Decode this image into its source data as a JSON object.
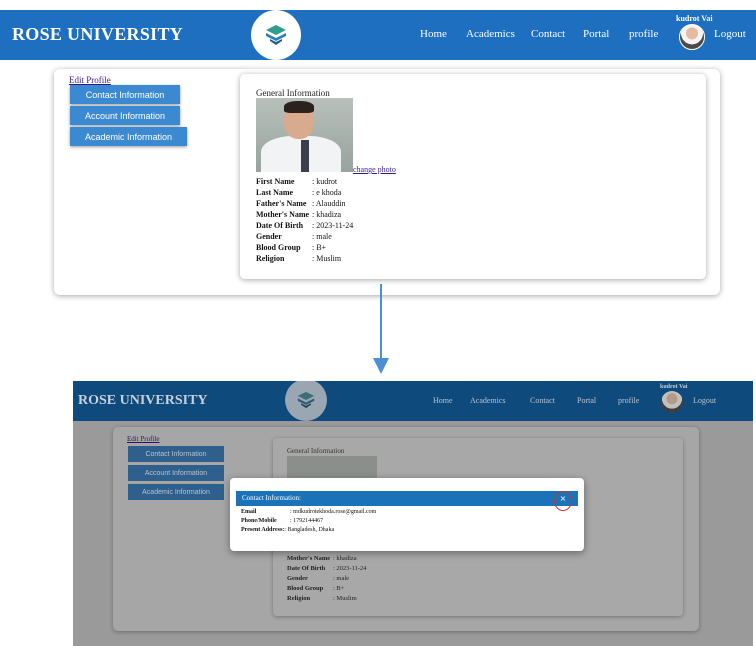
{
  "top_screen": {
    "nav": {
      "brand": "ROSE UNIVERSITY",
      "menu": [
        "Home",
        "Academics",
        "Contact",
        "Portal",
        "profile"
      ],
      "user_name": "kudrot Vai",
      "logout": "Logout",
      "bar_color": "#1e6fbf"
    },
    "sidebar": {
      "edit_profile": "Edit Profile",
      "buttons": [
        "Contact Information",
        "Account Information",
        "Academic Information"
      ]
    },
    "general": {
      "title": "General Information",
      "change_photo": "change photo",
      "rows": [
        {
          "label": "First Name",
          "value": ": kudrot"
        },
        {
          "label": "Last Name",
          "value": ": e khoda"
        },
        {
          "label": "Father's Name",
          "value": ": Alauddin"
        },
        {
          "label": "Mother's Name",
          "value": ": khadiza"
        },
        {
          "label": "Date Of Birth",
          "value": ": 2023-11-24"
        },
        {
          "label": "Gender",
          "value": ": male"
        },
        {
          "label": "Blood Group",
          "value": ": B+"
        },
        {
          "label": "Religion",
          "value": ": Muslim"
        }
      ]
    }
  },
  "bottom_screen": {
    "nav": {
      "brand": "ROSE UNIVERSITY",
      "menu": [
        "Home",
        "Academics",
        "Contact",
        "Portal",
        "profile"
      ],
      "user_name": "kudrot Vai",
      "logout": "Logout"
    },
    "sidebar": {
      "edit_profile": "Edit Profile",
      "buttons": [
        "Contact Information",
        "Account Information",
        "Academic Information"
      ]
    },
    "general": {
      "title": "General Information",
      "rows": [
        {
          "label": "Mother's Name",
          "value": ": khadiza"
        },
        {
          "label": "Date Of Birth",
          "value": ": 2023-11-24"
        },
        {
          "label": "Gender",
          "value": ": male"
        },
        {
          "label": "Blood Group",
          "value": ": B+"
        },
        {
          "label": "Religion",
          "value": ": Muslim"
        }
      ]
    },
    "modal": {
      "title": "Contact Information:",
      "close": "×",
      "rows": [
        {
          "label": "Email",
          "value": ": mdkudrotekhoda.rose@gmail.com"
        },
        {
          "label": "Phone/Mobile",
          "value": ": 1792144467"
        },
        {
          "label": "Present Address:",
          "value": ": Bangladesh, Dhaka"
        }
      ]
    }
  },
  "icons": {
    "logo": "book-stack-logo-icon",
    "arrow": "down-arrow-icon"
  },
  "colors": {
    "accent": "#3b89d1",
    "modal_header": "#1a73b8",
    "close_highlight": "#c0392b"
  }
}
